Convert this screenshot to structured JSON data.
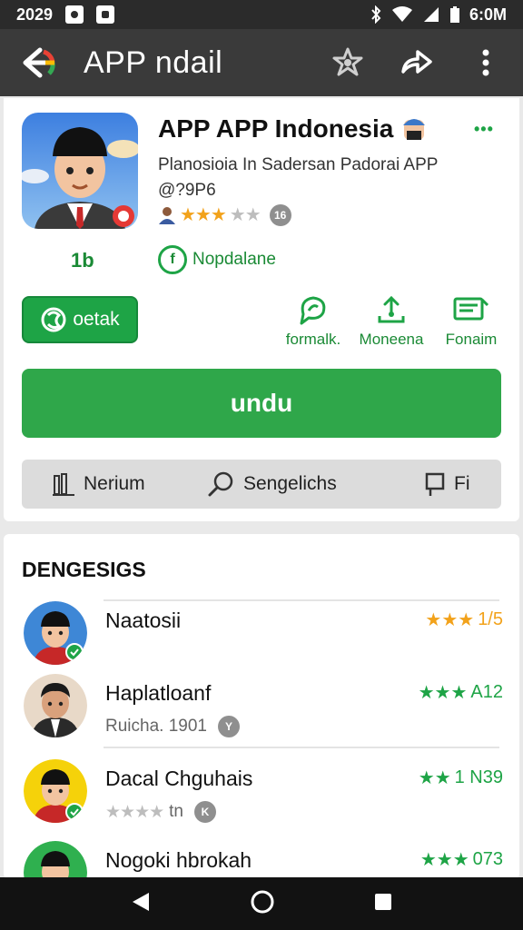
{
  "status": {
    "time_left": "2029",
    "time_right": "6:0M"
  },
  "appbar": {
    "title": "APP ndail"
  },
  "app": {
    "title": "APP APP Indonesia",
    "subtitle": "Planosioia In Sadersan Padorai APP @?9P6",
    "rating_badge": "16",
    "stat": "1b",
    "developer": "Nopdalane",
    "details_label": "oetak",
    "actions": [
      {
        "label": "formalk."
      },
      {
        "label": "Moneena"
      },
      {
        "label": "Fonaim"
      }
    ],
    "install_label": "undu",
    "tabs": [
      {
        "label": "Nerium"
      },
      {
        "label": "Sengelichs"
      },
      {
        "label": "Fi"
      }
    ]
  },
  "list": {
    "title": "DENGESIGS",
    "items": [
      {
        "name": "Naatosii",
        "meta": "",
        "meta_badge": "",
        "score": "1/5",
        "score_color": "gold"
      },
      {
        "name": "Haplatloanf",
        "meta": "Ruicha. 1901",
        "meta_badge": "Y",
        "score": "A12",
        "score_color": "green"
      },
      {
        "name": "Dacal Chguhais",
        "meta": "tn",
        "meta_badge": "K",
        "score": "1 N39",
        "score_color": "green"
      },
      {
        "name": "Nogoki hbrokah",
        "meta": "",
        "meta_badge": "",
        "score": "073",
        "score_color": "green"
      }
    ]
  },
  "colors": {
    "brand_green": "#1ea446",
    "star_gold": "#f2a21b"
  }
}
